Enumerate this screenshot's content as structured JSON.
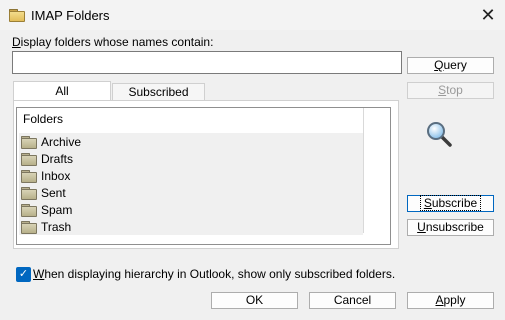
{
  "window": {
    "title": "IMAP Folders",
    "close_glyph": "✕"
  },
  "filter": {
    "label_accel": "D",
    "label_rest": "isplay folders whose names contain:",
    "value": "",
    "placeholder": ""
  },
  "buttons": {
    "query": {
      "accel": "Q",
      "rest": "uery"
    },
    "stop": {
      "accel": "S",
      "rest": "top"
    },
    "subscribe": {
      "accel": "S",
      "rest": "ubscribe"
    },
    "unsubscribe": {
      "accel": "U",
      "rest": "nsubscribe"
    },
    "ok": "OK",
    "cancel": "Cancel",
    "apply": {
      "accel": "A",
      "rest": "pply"
    }
  },
  "tabs": [
    {
      "label": "All",
      "active": true
    },
    {
      "label": "Subscribed",
      "active": false
    }
  ],
  "tree": {
    "header": "Folders",
    "folders": [
      "Archive",
      "Drafts",
      "Inbox",
      "Sent",
      "Spam",
      "Trash"
    ]
  },
  "option": {
    "checked": true,
    "check_glyph": "✓",
    "label_accel": "W",
    "label_rest": "hen displaying hierarchy in Outlook, show only subscribed folders."
  },
  "icons": {
    "title": "folder-icon",
    "search": "magnifier-icon",
    "tree_item": "folder-icon"
  },
  "colors": {
    "accent": "#0067c0",
    "background": "#f0f0f0"
  }
}
